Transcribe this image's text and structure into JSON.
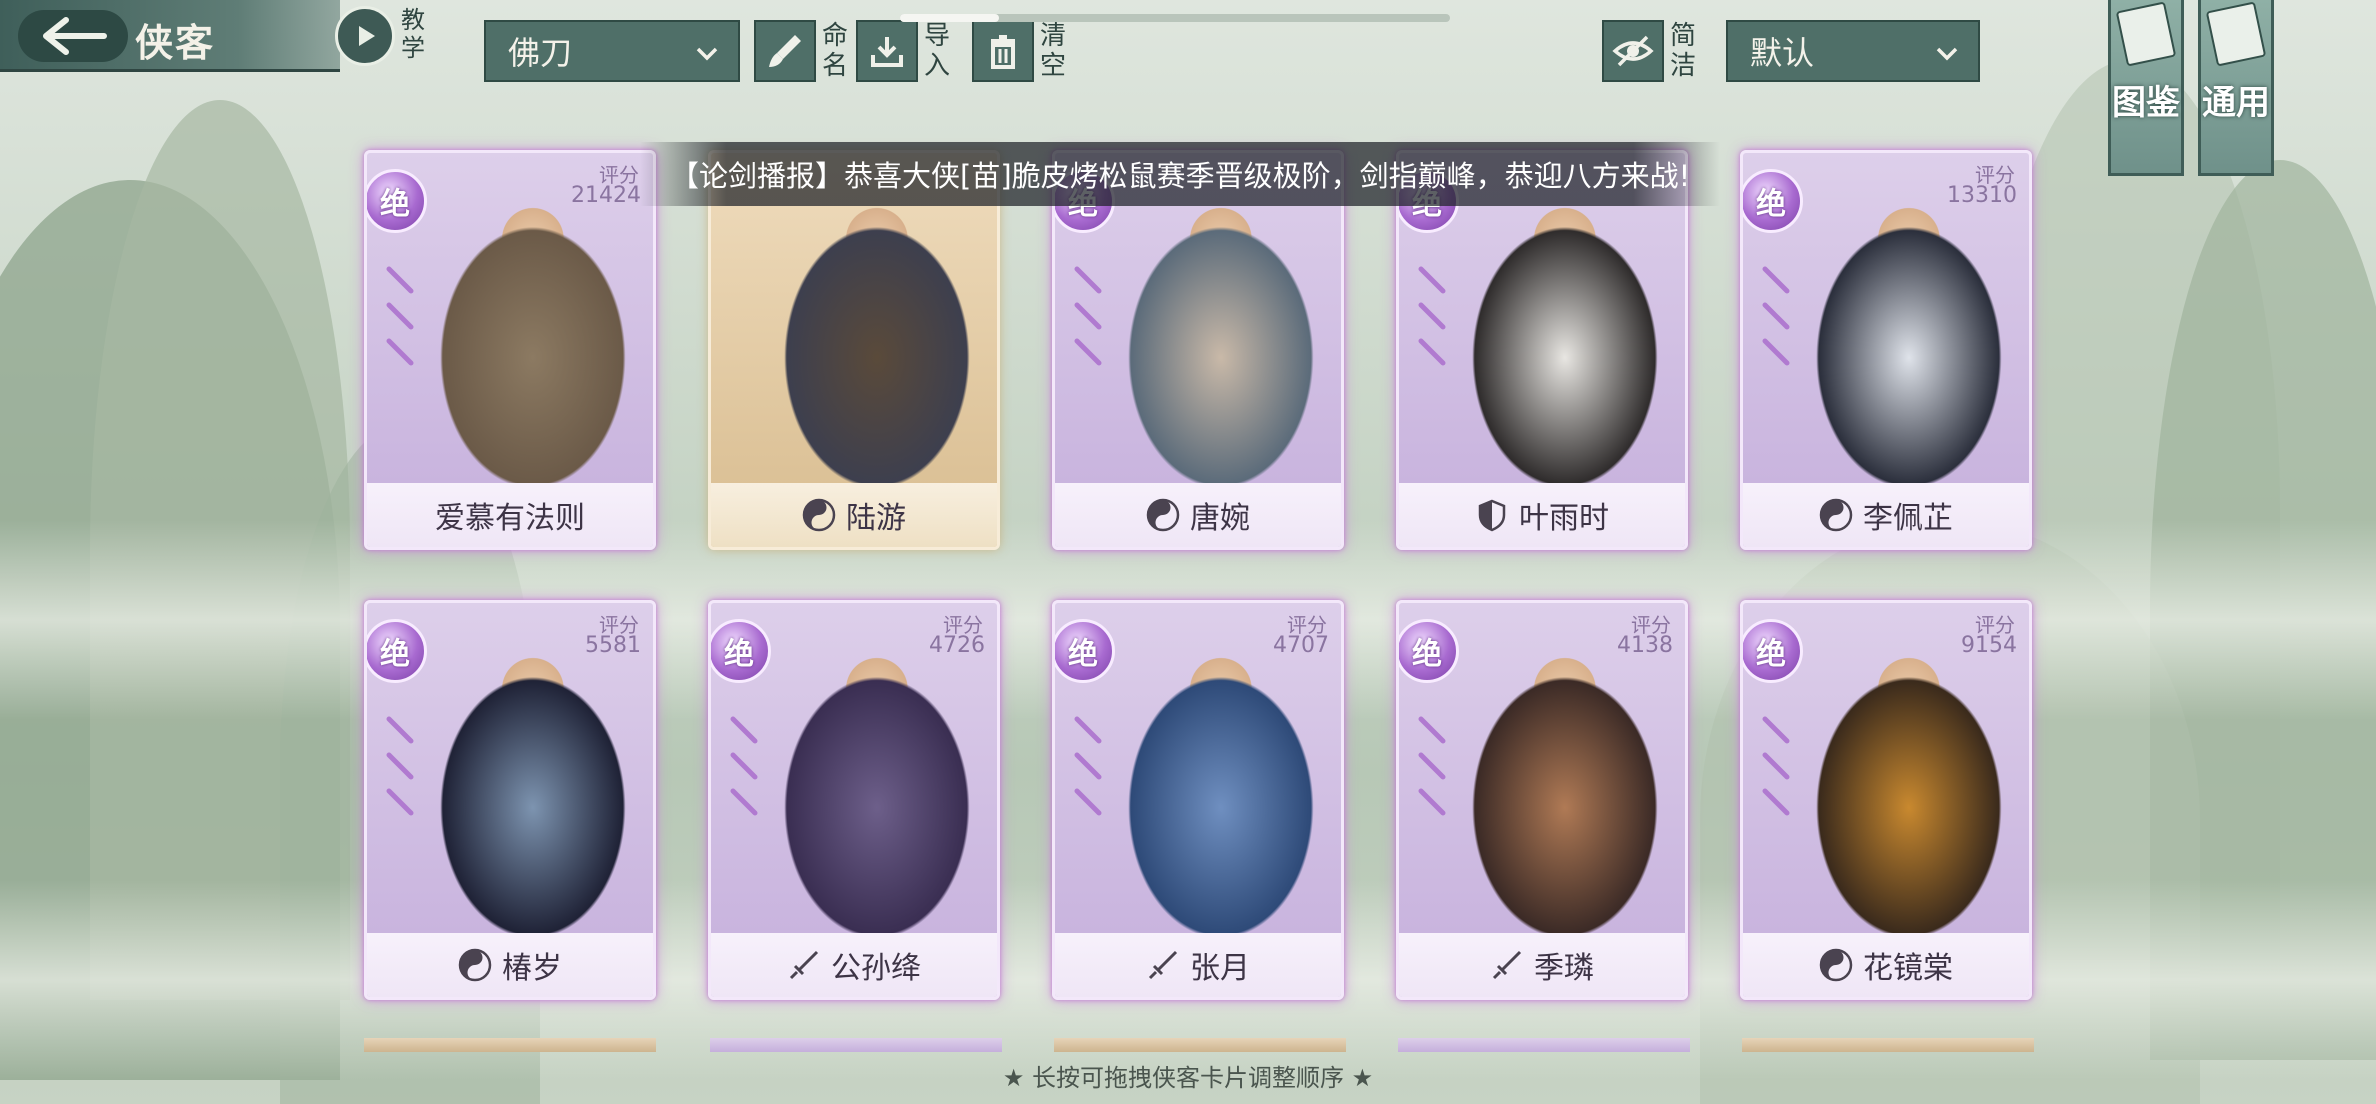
{
  "header": {
    "title": "侠客",
    "tutorial_label": "教学",
    "filter_value": "佛刀",
    "rename_label": "命名",
    "import_label": "导入",
    "clear_label": "清空",
    "simple_label": "简洁",
    "sort_value": "默认",
    "progress": 0.18
  },
  "side_tabs": [
    {
      "label": "图鉴"
    },
    {
      "label": "通用"
    }
  ],
  "broadcast": "【论剑播报】恭喜大侠[苗]脆皮烤松鼠赛季晋级极阶，剑指巅峰，恭迎八方来战!",
  "cards": [
    {
      "name": "爱慕有法则",
      "badge": "绝",
      "score_label": "评分",
      "score": "21424",
      "school": "none"
    },
    {
      "name": "陆游",
      "badge": "",
      "score_label": "",
      "score": "",
      "school": "taiji"
    },
    {
      "name": "唐婉",
      "badge": "绝",
      "score_label": "",
      "score": "",
      "school": "taiji"
    },
    {
      "name": "叶雨时",
      "badge": "绝",
      "score_label": "",
      "score": "",
      "school": "shield"
    },
    {
      "name": "李佩芷",
      "badge": "绝",
      "score_label": "评分",
      "score": "13310",
      "school": "taiji"
    },
    {
      "name": "椿岁",
      "badge": "绝",
      "score_label": "评分",
      "score": "5581",
      "school": "taiji"
    },
    {
      "name": "公孙绛",
      "badge": "绝",
      "score_label": "评分",
      "score": "4726",
      "school": "sword"
    },
    {
      "name": "张月",
      "badge": "绝",
      "score_label": "评分",
      "score": "4707",
      "school": "sword"
    },
    {
      "name": "季璘",
      "badge": "绝",
      "score_label": "评分",
      "score": "4138",
      "school": "sword"
    },
    {
      "name": "花镜棠",
      "badge": "绝",
      "score_label": "评分",
      "score": "9154",
      "school": "taiji"
    }
  ],
  "hint": "★ 长按可拖拽侠客卡片调整顺序 ★",
  "colors": {
    "accent": "#4f6f68",
    "card_purple": "#c5afdc",
    "card_gold": "#d8bc8f"
  }
}
